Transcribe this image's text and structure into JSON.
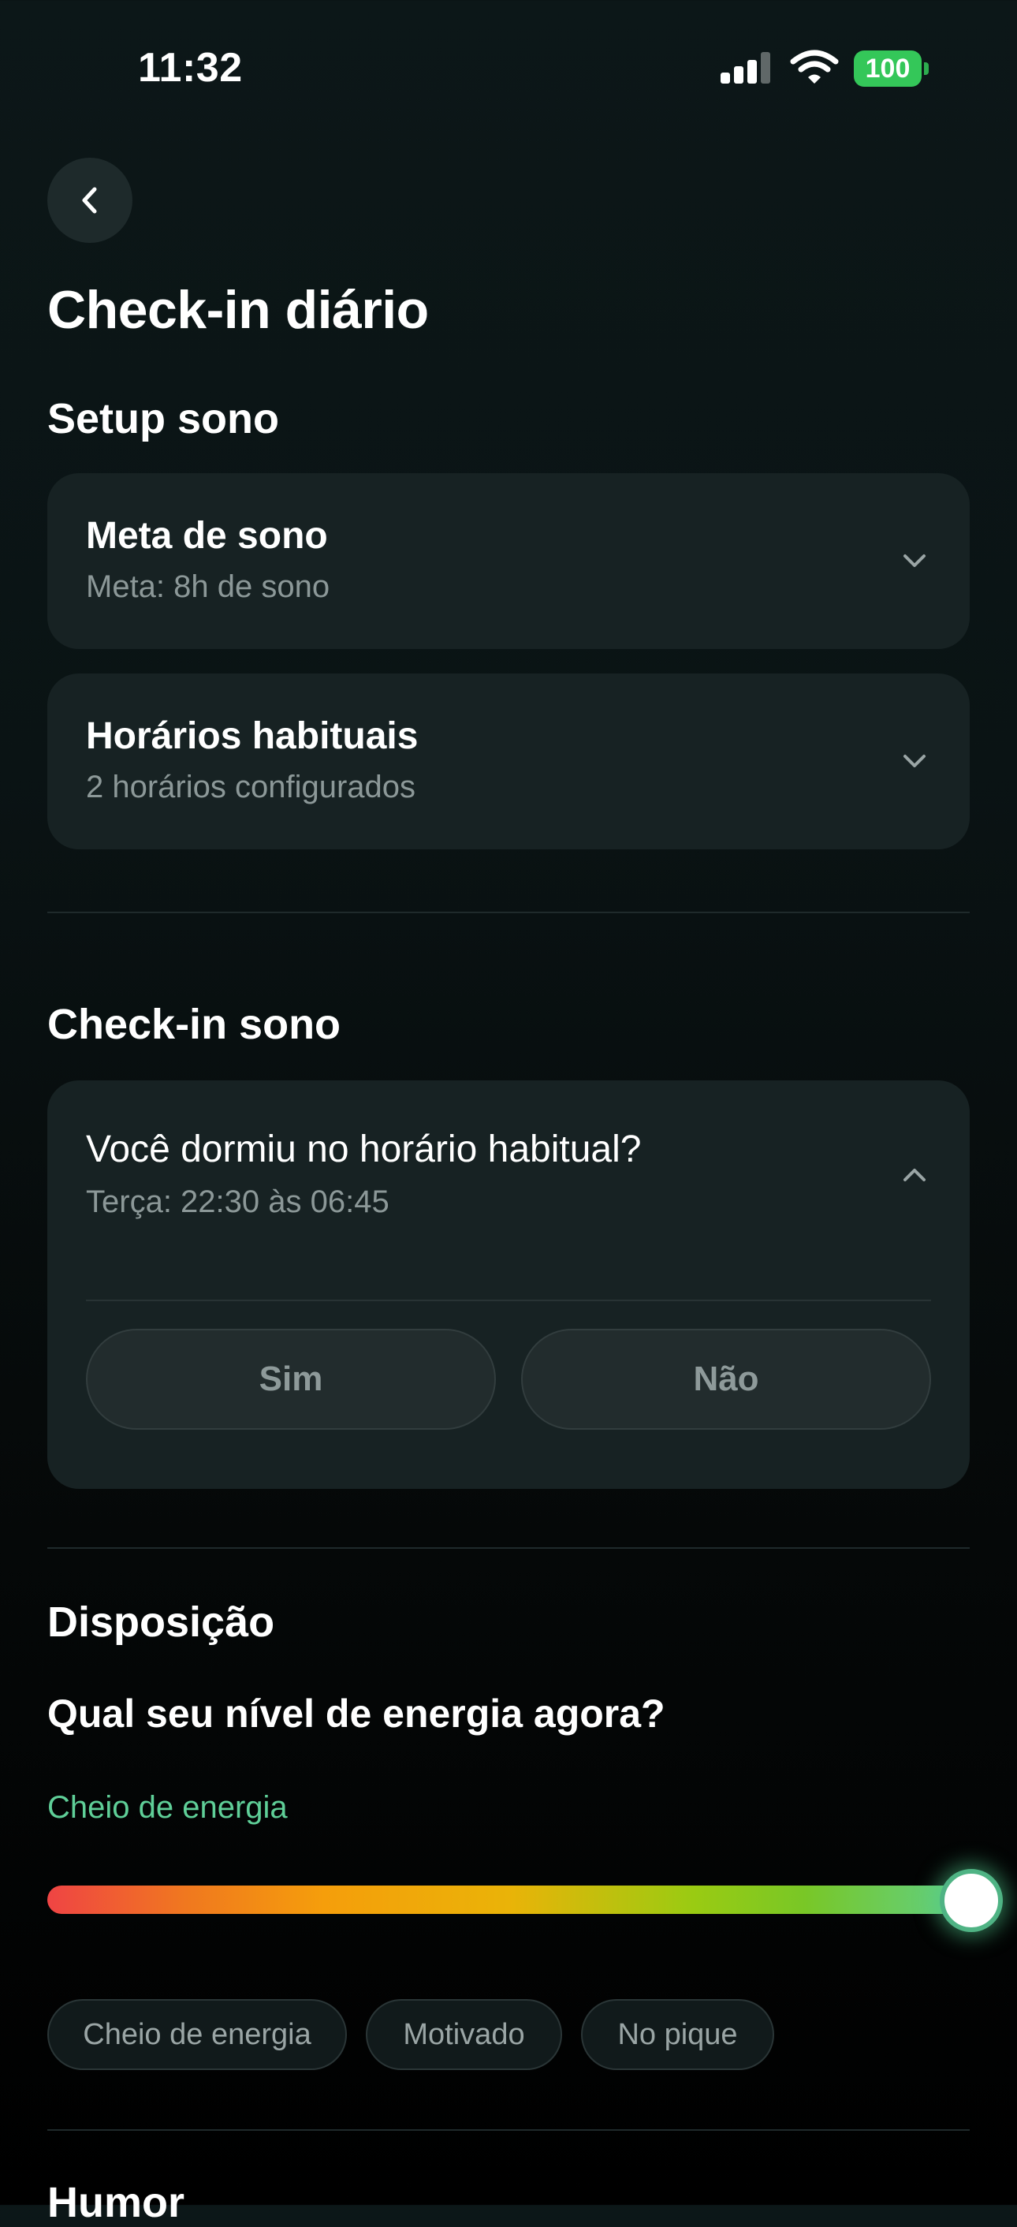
{
  "status_bar": {
    "time": "11:32",
    "battery": "100",
    "signal_icon": "cellular-signal-icon",
    "wifi_icon": "wifi-icon"
  },
  "header": {
    "back_icon": "chevron-left-icon",
    "title": "Check-in diário"
  },
  "setup_sono": {
    "heading": "Setup sono",
    "cards": [
      {
        "title": "Meta de sono",
        "subtitle": "Meta: 8h de sono"
      },
      {
        "title": "Horários habituais",
        "subtitle": "2 horários configurados"
      }
    ]
  },
  "checkin_sono": {
    "heading": "Check-in sono",
    "question": "Você dormiu no horário habitual?",
    "subtitle": "Terça: 22:30 às 06:45",
    "yes_label": "Sim",
    "no_label": "Não"
  },
  "disposicao": {
    "heading": "Disposição",
    "question": "Qual seu nível de energia agora?",
    "current_label": "Cheio de energia",
    "energy_level": 1.0,
    "chips": [
      "Cheio de energia",
      "Motivado",
      "No pique"
    ]
  },
  "humor": {
    "heading": "Humor"
  },
  "colors": {
    "accent_green": "#5fcf98",
    "card_bg": "#172223",
    "battery_green": "#34c759"
  }
}
